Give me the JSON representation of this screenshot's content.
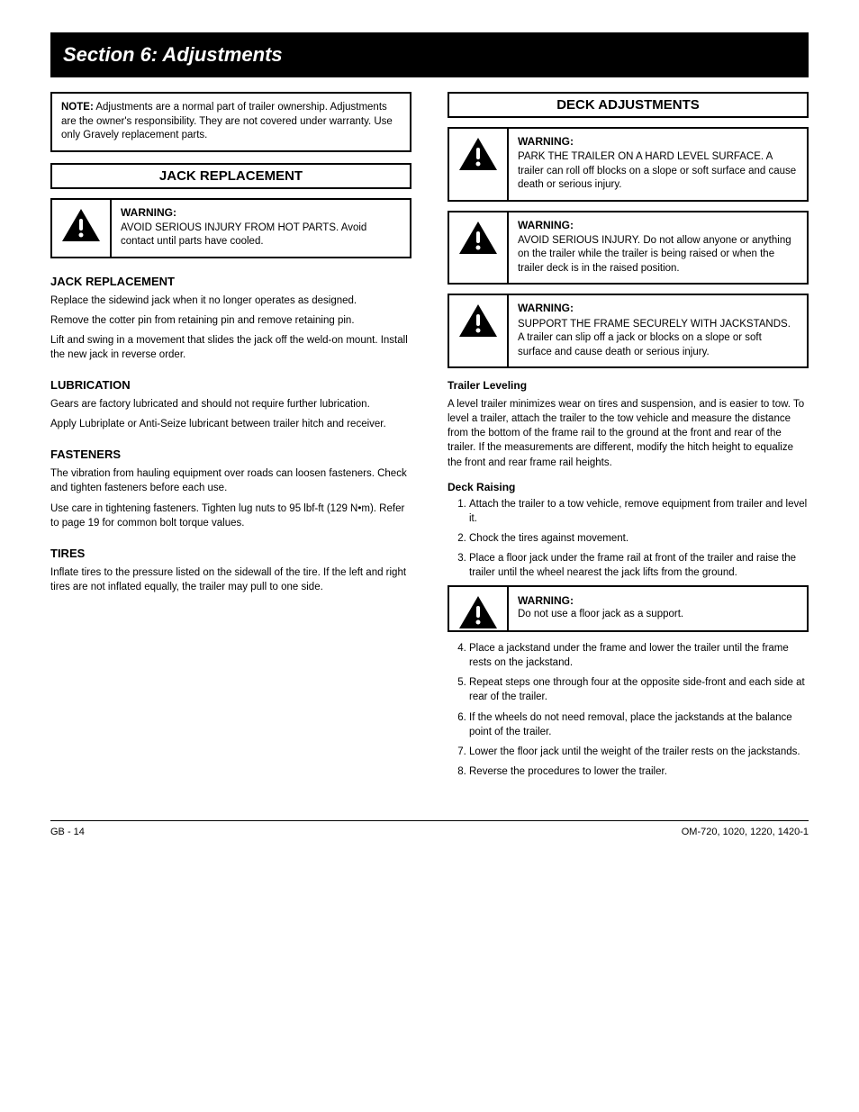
{
  "banner": {
    "title": "Section 6: Adjustments"
  },
  "left": {
    "note": {
      "label": "NOTE:",
      "text": " Adjustments are a normal part of trailer ownership. Adjustments are the owner's responsibility. They are not covered under warranty. Use only Gravely replacement parts."
    },
    "sectionHeader": "JACK REPLACEMENT",
    "warning": {
      "label": "WARNING:",
      "text": " AVOID SERIOUS INJURY FROM HOT PARTS. Avoid contact until parts have cooled."
    },
    "sub1": {
      "heading": "JACK REPLACEMENT",
      "p1": "Replace the sidewind jack when it no longer operates as designed.",
      "p2": "Remove the cotter pin from retaining pin and remove retaining pin.",
      "p3": "Lift and swing in a movement that slides the jack off the weld-on mount. Install the new jack in reverse order."
    },
    "sub2": {
      "heading": "LUBRICATION",
      "p1": "Gears are factory lubricated and should not require further lubrication.",
      "p2": "Apply Lubriplate or Anti-Seize lubricant between trailer hitch and receiver."
    },
    "sub3": {
      "heading": "FASTENERS",
      "p1": "The vibration from hauling equipment over roads can loosen fasteners. Check and tighten fasteners before each use.",
      "p2": "Use care in tightening fasteners. Tighten lug nuts to 95 lbf-ft (129 N•m). Refer to page 19 for common bolt torque values."
    },
    "sub4": {
      "heading": "TIRES",
      "p1": "Inflate tires to the pressure listed on the sidewall of the tire. If the left and right tires are not inflated equally, the trailer may pull to one side."
    }
  },
  "right": {
    "sectionHeader": "DECK ADJUSTMENTS",
    "warn1": {
      "label": "WARNING:",
      "text": " PARK THE TRAILER ON A HARD LEVEL SURFACE. A trailer can roll off blocks on a slope or soft surface and cause death or serious injury."
    },
    "warn2": {
      "label": "WARNING:",
      "text": " AVOID SERIOUS INJURY. Do not allow anyone or anything on the trailer while the trailer is being raised or when the trailer deck is in the raised position."
    },
    "warn3": {
      "label": "WARNING:",
      "text": " SUPPORT THE FRAME SECURELY WITH JACKSTANDS. A trailer can slip off a jack or blocks on a slope or soft surface and cause death or serious injury."
    },
    "sub1": {
      "heading": "Trailer Leveling",
      "p": "A level trailer minimizes wear on tires and suspension, and is easier to tow. To level a trailer, attach the trailer to the tow vehicle and measure the distance from the bottom of the frame rail to the ground at the front and rear of the trailer. If the measurements are different, modify the hitch height to equalize the front and rear frame rail heights."
    },
    "sub2": {
      "heading": "Deck Raising",
      "steps": [
        "Attach the trailer to a tow vehicle, remove equipment from trailer and level it.",
        "Chock the tires against movement.",
        "Place a floor jack under the frame rail at front of the trailer and raise the trailer until the wheel nearest the jack lifts from the ground."
      ]
    },
    "warnShort": {
      "label": "WARNING:",
      "text": " Do not use a floor jack as a support."
    },
    "stepsCont": [
      "Place a jackstand under the frame and lower the trailer until the frame rests on the jackstand.",
      "Repeat steps one through four at the opposite side-front and each side at rear of the trailer.",
      "If the wheels do not need removal, place the jackstands at the balance point of the trailer.",
      "Lower the floor jack until the weight of the trailer rests on the jackstands.",
      "Reverse the procedures to lower the trailer."
    ]
  },
  "footer": {
    "left": "GB - 14",
    "right": "OM-720, 1020, 1220, 1420-1"
  }
}
